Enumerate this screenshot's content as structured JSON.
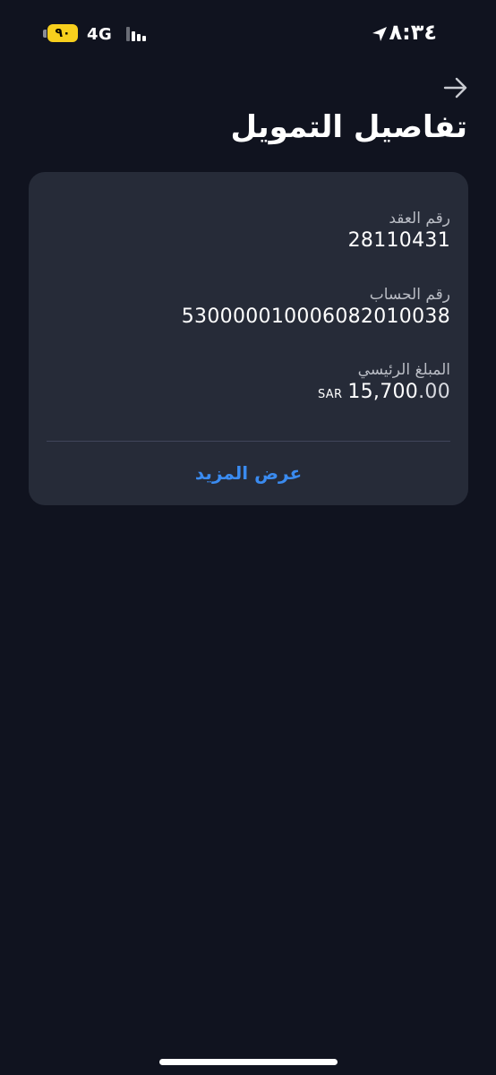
{
  "status_bar": {
    "battery_level": "٩٠",
    "network": "4G",
    "time": "٨:٣٤",
    "battery_color": "#f7cf1d"
  },
  "header": {
    "back_icon": "arrow-right-icon",
    "title": "تفاصيل التمويل"
  },
  "details": {
    "contract_number_label": "رقم العقد",
    "contract_number": "28110431",
    "account_number_label": "رقم الحساب",
    "account_number": "530000010006082010038",
    "principal_label": "المبلغ الرئيسي",
    "principal_currency": "SAR",
    "principal_amount": "15,700",
    "principal_decimals": ".00",
    "show_more": "عرض المزيد",
    "link_color": "#3a8bf0"
  }
}
